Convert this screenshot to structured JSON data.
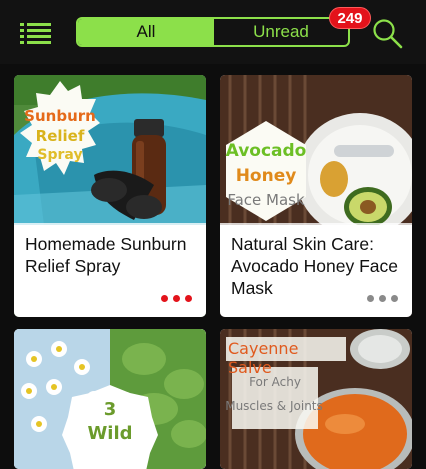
{
  "header": {
    "tabs": [
      {
        "label": "All",
        "selected": true
      },
      {
        "label": "Unread",
        "selected": false
      }
    ],
    "unread_count": "249",
    "accent_color": "#8ce04a",
    "badge_color": "#e3131b",
    "icons": {
      "menu": "list-menu-icon",
      "search": "search-icon"
    }
  },
  "cards": [
    {
      "title": "Homemade Sunburn Relief Spray",
      "image_text": [
        "Sunburn",
        "Relief",
        "Spray"
      ],
      "unread": true
    },
    {
      "title": "Natural Skin Care: Avocado Honey Face Mask",
      "image_text": [
        "Avocado",
        "Honey",
        "Face Mask"
      ],
      "unread": false
    },
    {
      "title": "",
      "image_text": [
        "3",
        "Wild"
      ],
      "unread": null
    },
    {
      "title": "",
      "image_text": [
        "Cayenne Salve",
        "For Achy",
        "Muscles & Joints"
      ],
      "unread": null
    }
  ],
  "dot_colors": {
    "unread": "#e3131b",
    "read": "#8a8a8a"
  }
}
